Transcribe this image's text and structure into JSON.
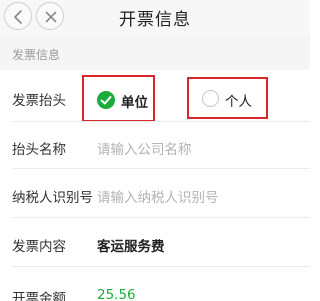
{
  "header": {
    "title": "开票信息"
  },
  "section": {
    "title": "发票信息"
  },
  "invoice_header": {
    "label": "发票抬头",
    "options": [
      {
        "label": "单位",
        "selected": true
      },
      {
        "label": "个人",
        "selected": false
      }
    ]
  },
  "company_name": {
    "label": "抬头名称",
    "placeholder": "请输入公司名称"
  },
  "tax_id": {
    "label": "纳税人识别号",
    "placeholder": "请输入纳税人识别号"
  },
  "content": {
    "label": "发票内容",
    "value": "客运服务费"
  },
  "amount": {
    "label": "开票金额",
    "value": "25.56"
  },
  "colors": {
    "accent_green": "#1aad3c",
    "highlight_red": "#d9262b"
  }
}
